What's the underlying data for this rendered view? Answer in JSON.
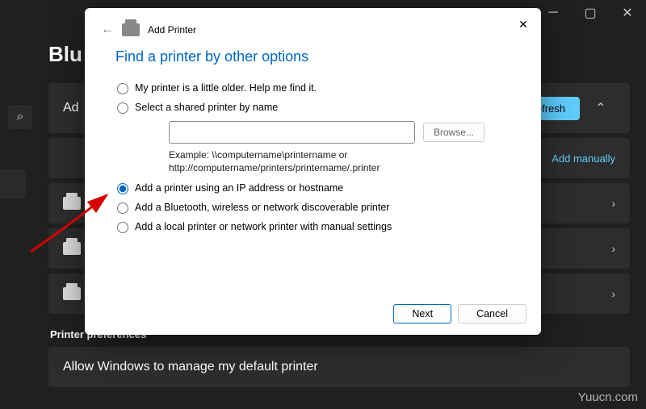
{
  "bg": {
    "heading": "Blu",
    "add_label": "Ad",
    "refresh": "Refresh",
    "add_manually": "Add manually",
    "pref_heading": "Printer preferences",
    "allow_default": "Allow Windows to manage my default printer"
  },
  "dialog": {
    "title": "Add Printer",
    "subtitle": "Find a printer by other options",
    "opts": {
      "older": "My printer is a little older. Help me find it.",
      "shared": "Select a shared printer by name",
      "browse": "Browse...",
      "example": "Example: \\\\computername\\printername or http://computername/printers/printername/.printer",
      "ip": "Add a printer using an IP address or hostname",
      "bt": "Add a Bluetooth, wireless or network discoverable printer",
      "local": "Add a local printer or network printer with manual settings"
    },
    "next": "Next",
    "cancel": "Cancel"
  },
  "watermark": "Yuucn.com"
}
